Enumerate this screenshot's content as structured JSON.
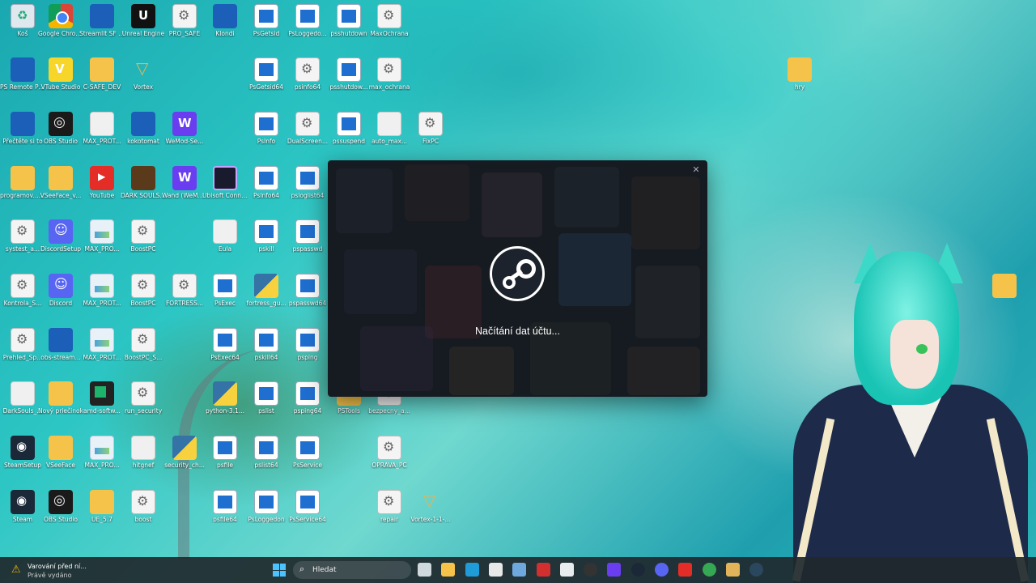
{
  "desktop": {
    "icons": [
      {
        "label": "Koš",
        "icon": "recycle-bin-icon"
      },
      {
        "label": "Google Chrome",
        "icon": "chrome-icon"
      },
      {
        "label": "Streamlit SF Lock",
        "icon": "app-icon"
      },
      {
        "label": "Unreal Engine",
        "icon": "unreal-engine-icon"
      },
      {
        "label": "PRO_SAFE",
        "icon": "settings-file-icon"
      },
      {
        "label": "Klondi",
        "icon": "app-icon"
      },
      {
        "label": "PsGetsid",
        "icon": "window-app-icon"
      },
      {
        "label": "PsLoggedo...",
        "icon": "window-app-icon"
      },
      {
        "label": "psshutdown",
        "icon": "window-app-icon"
      },
      {
        "label": "MaxOchrana",
        "icon": "settings-file-icon"
      },
      {
        "label": "PS Remote Play",
        "icon": "remote-play-icon"
      },
      {
        "label": "VTube Studio",
        "icon": "vtube-studio-icon"
      },
      {
        "label": "C-SAFE_DEV",
        "icon": "folder-icon"
      },
      {
        "label": "Vortex",
        "icon": "vortex-icon"
      },
      {
        "label": "PsGetsid64",
        "icon": "window-app-icon"
      },
      {
        "label": "psinfo64",
        "icon": "settings-file-icon"
      },
      {
        "label": "psshutdow...",
        "icon": "window-app-icon"
      },
      {
        "label": "max_ochrana",
        "icon": "settings-file-icon"
      },
      {
        "label": "Přečtěte si to",
        "icon": "app-icon"
      },
      {
        "label": "OBS Studio",
        "icon": "obs-icon"
      },
      {
        "label": "MAX_PROT...",
        "icon": "document-icon"
      },
      {
        "label": "kokotomat",
        "icon": "app-icon"
      },
      {
        "label": "WeMod-Se...",
        "icon": "wemod-icon"
      },
      {
        "label": "PsInfo",
        "icon": "window-app-icon"
      },
      {
        "label": "DualScreen...",
        "icon": "settings-file-icon"
      },
      {
        "label": "pssuspend",
        "icon": "window-app-icon"
      },
      {
        "label": "auto_max...",
        "icon": "document-icon"
      },
      {
        "label": "FixPC",
        "icon": "settings-file-icon"
      },
      {
        "label": "programov... hier",
        "icon": "folder-icon"
      },
      {
        "label": "VSeeFace_v...",
        "icon": "folder-icon"
      },
      {
        "label": "YouTube",
        "icon": "youtube-icon"
      },
      {
        "label": "DARK SOULS™ II",
        "icon": "dark-souls-icon"
      },
      {
        "label": "Wand (WeMod)",
        "icon": "wemod-icon"
      },
      {
        "label": "Ubisoft Connect",
        "icon": "ubisoft-icon"
      },
      {
        "label": "PsInfo64",
        "icon": "window-app-icon"
      },
      {
        "label": "psloglist64",
        "icon": "window-app-icon"
      },
      {
        "label": "systest_a...",
        "icon": "settings-file-icon"
      },
      {
        "label": "DiscordSetup",
        "icon": "discord-icon"
      },
      {
        "label": "MAX_PRO...",
        "icon": "image-file-icon"
      },
      {
        "label": "BoostPC",
        "icon": "settings-file-icon"
      },
      {
        "label": "Eula",
        "icon": "document-icon"
      },
      {
        "label": "pskill",
        "icon": "window-app-icon"
      },
      {
        "label": "pspasswd",
        "icon": "window-app-icon"
      },
      {
        "label": "Kontrola_S...",
        "icon": "settings-file-icon"
      },
      {
        "label": "Discord",
        "icon": "discord-icon"
      },
      {
        "label": "MAX_PROT...",
        "icon": "image-file-icon"
      },
      {
        "label": "BoostPC",
        "icon": "settings-file-icon"
      },
      {
        "label": "FORTRESS...",
        "icon": "settings-file-icon"
      },
      {
        "label": "PsExec",
        "icon": "window-app-icon"
      },
      {
        "label": "fortress_gu...",
        "icon": "python-icon"
      },
      {
        "label": "pspasswd64",
        "icon": "window-app-icon"
      },
      {
        "label": "Prehled_Sp...",
        "icon": "settings-file-icon"
      },
      {
        "label": "obs-stream...",
        "icon": "app-icon"
      },
      {
        "label": "MAX_PROT...",
        "icon": "image-file-icon"
      },
      {
        "label": "BoostPC_S...",
        "icon": "settings-file-icon"
      },
      {
        "label": "PsExec64",
        "icon": "window-app-icon"
      },
      {
        "label": "pskill64",
        "icon": "window-app-icon"
      },
      {
        "label": "psping",
        "icon": "window-app-icon"
      },
      {
        "label": "DarkSouls_...",
        "icon": "document-icon"
      },
      {
        "label": "Nový priečinok",
        "icon": "folder-icon"
      },
      {
        "label": "amd-softw...",
        "icon": "amd-icon"
      },
      {
        "label": "run_security",
        "icon": "settings-file-icon"
      },
      {
        "label": "python-3.1...",
        "icon": "python-icon"
      },
      {
        "label": "pslist",
        "icon": "window-app-icon"
      },
      {
        "label": "psping64",
        "icon": "window-app-icon"
      },
      {
        "label": "PSTools",
        "icon": "folder-icon"
      },
      {
        "label": "bezpecny_a...",
        "icon": "settings-file-icon"
      },
      {
        "label": "SteamSetup",
        "icon": "steam-icon"
      },
      {
        "label": "VSeeFace",
        "icon": "folder-icon"
      },
      {
        "label": "MAX_PRO...",
        "icon": "image-file-icon"
      },
      {
        "label": "hitgnef",
        "icon": "document-icon"
      },
      {
        "label": "security_ch...",
        "icon": "python-icon"
      },
      {
        "label": "psfile",
        "icon": "window-app-icon"
      },
      {
        "label": "pslist64",
        "icon": "window-app-icon"
      },
      {
        "label": "PsService",
        "icon": "window-app-icon"
      },
      {
        "label": "OPRAVA_PC",
        "icon": "settings-file-icon"
      },
      {
        "label": "Steam",
        "icon": "steam-icon"
      },
      {
        "label": "OBS Studio",
        "icon": "obs-icon"
      },
      {
        "label": "UE_5.7",
        "icon": "folder-icon"
      },
      {
        "label": "boost",
        "icon": "settings-file-icon"
      },
      {
        "label": "psfile64",
        "icon": "window-app-icon"
      },
      {
        "label": "PsLoggedon",
        "icon": "window-app-icon"
      },
      {
        "label": "PsService64",
        "icon": "window-app-icon"
      },
      {
        "label": "repair",
        "icon": "settings-file-icon"
      },
      {
        "label": "Vortex-1-1-...",
        "icon": "vortex-icon"
      },
      {
        "label": "hry",
        "icon": "folder-icon"
      },
      {
        "label": "",
        "icon": "folder-icon"
      }
    ]
  },
  "steam_dialog": {
    "status_text": "Načítání dat účtu...",
    "close_glyph": "✕",
    "logo": "steam-logo-icon"
  },
  "taskbar": {
    "notification": {
      "title": "Varování před ní...",
      "subtitle": "Právě vydáno"
    },
    "search_placeholder": "Hledat",
    "pinned": [
      "task-view-icon",
      "file-explorer-icon",
      "edge-icon",
      "store-icon",
      "snipping-icon",
      "amd-icon",
      "vtube-icon",
      "obs-icon",
      "wemod-icon",
      "steam-icon",
      "discord-icon",
      "youtube-icon",
      "chrome-icon",
      "vortex-icon",
      "steam-active-icon"
    ]
  },
  "colors": {
    "taskbar_bg": "#20282c",
    "steam_bg": "#161a21",
    "accent": "#4cc2ff"
  }
}
